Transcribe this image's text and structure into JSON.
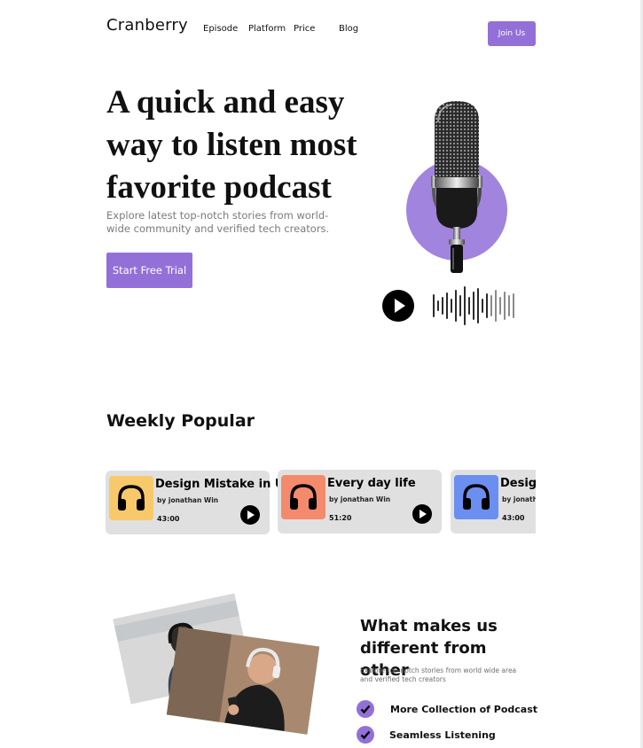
{
  "header": {
    "logo": "Cranberry",
    "nav": [
      "Episode",
      "Platform",
      "Price",
      "Blog"
    ],
    "join_label": "Join Us"
  },
  "hero": {
    "title_lines": [
      "A quick and easy",
      "way to listen most",
      "favorite podcast"
    ],
    "subtitle": "Explore latest top-notch stories from world-wide community and verified tech creators.",
    "cta_label": "Start Free Trial"
  },
  "popular": {
    "title": "Weekly Popular",
    "cards": [
      {
        "title": "Design Mistake in UI",
        "author": "by jonathan Win",
        "duration": "43:00",
        "color": "#f7c96b"
      },
      {
        "title": "Every day life",
        "author": "by jonathan Win",
        "duration": "51:20",
        "color": "#f48a6c"
      },
      {
        "title": "Design Mistake in UI",
        "author": "by jonathan Win",
        "duration": "43:00",
        "color": "#6a8ff0"
      }
    ]
  },
  "different": {
    "title": "What makes us different from other",
    "subtitle": "Explore top-notch stories from world wide area and verified tech creators",
    "features": [
      "More Collection of Podcast",
      "Seamless Listening"
    ]
  },
  "colors": {
    "accent": "#9370d8",
    "accent_light": "#a184dd"
  }
}
